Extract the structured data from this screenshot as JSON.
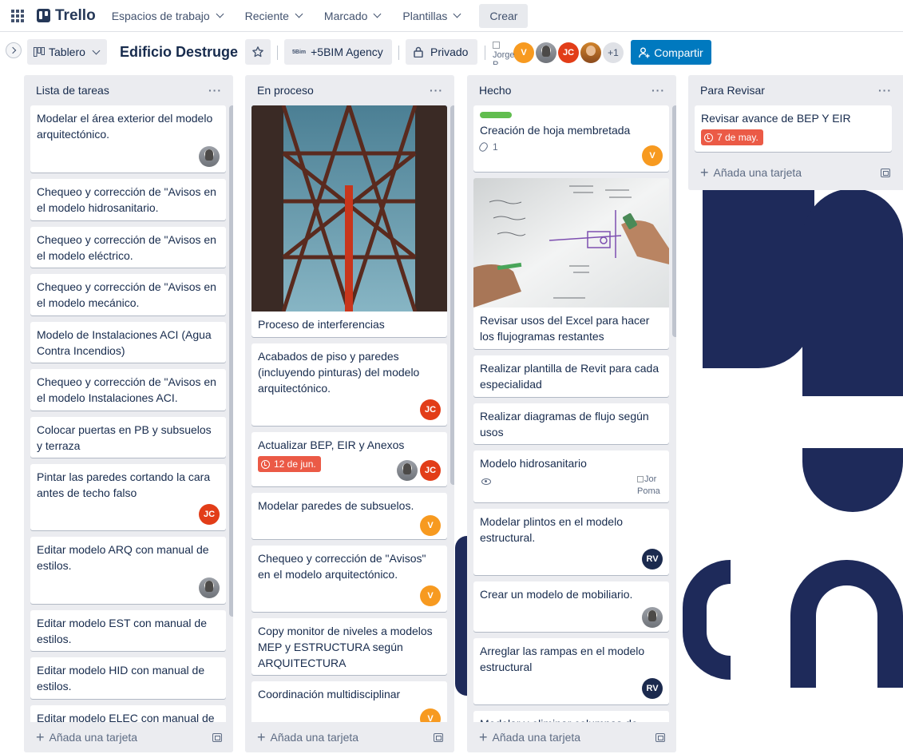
{
  "topnav": {
    "logo": "Trello",
    "items": [
      "Espacios de trabajo",
      "Reciente",
      "Marcado",
      "Plantillas"
    ],
    "create": "Crear"
  },
  "board": {
    "view": "Tablero",
    "title": "Edificio Destruge",
    "workspace_logo": "5Bim",
    "workspace": "+5BIM Agency",
    "visibility": "Privado",
    "members_broken_alt": "Jorge P",
    "members_extra": "+1",
    "share": "Compartir"
  },
  "lists": [
    {
      "title": "Lista de tareas",
      "add_card": "Añada una tarjeta",
      "cards": [
        {
          "text": "Modelar el área exterior del modelo arquitectónico.",
          "members": [
            "photo"
          ]
        },
        {
          "text": "Chequeo y corrección de \"Avisos en el modelo hidrosanitario.",
          "members": []
        },
        {
          "text": "Chequeo y corrección de \"Avisos en el modelo eléctrico.",
          "members": []
        },
        {
          "text": "Chequeo y corrección de \"Avisos en el modelo mecánico.",
          "members": []
        },
        {
          "text": "Modelo de Instalaciones ACI (Agua Contra Incendios)",
          "members": []
        },
        {
          "text": "Chequeo y corrección de \"Avisos en el modelo Instalaciones ACI.",
          "members": []
        },
        {
          "text": "Colocar puertas en PB y subsuelos y terraza",
          "members": []
        },
        {
          "text": "Pintar las paredes cortando la cara antes de techo falso",
          "members": [
            "JC"
          ]
        },
        {
          "text": "Editar modelo ARQ con manual de estilos.",
          "members": [
            "photo"
          ]
        },
        {
          "text": "Editar modelo EST con manual de estilos.",
          "members": []
        },
        {
          "text": "Editar modelo HID con manual de estilos.",
          "members": []
        },
        {
          "text": "Editar modelo ELEC con manual de estilos.",
          "members": []
        }
      ]
    },
    {
      "title": "En proceso",
      "add_card": "Añada una tarjeta",
      "cards": [
        {
          "text": "Proceso de interferencias",
          "members": []
        },
        {
          "text": "Acabados de piso y paredes (incluyendo pinturas) del modelo arquitectónico.",
          "members": [
            "JC"
          ]
        },
        {
          "text": "Actualizar BEP, EIR y Anexos",
          "due": "12 de jun.",
          "members": [
            "photo",
            "JC"
          ]
        },
        {
          "text": "Modelar paredes de subsuelos.",
          "members": [
            "V"
          ]
        },
        {
          "text": "Chequeo y corrección de \"Avisos\" en el modelo arquitectónico.",
          "members": [
            "V"
          ]
        },
        {
          "text": "Copy monitor de niveles a modelos MEP y ESTRUCTURA según ARQUITECTURA",
          "members": []
        },
        {
          "text": "Coordinación multidisciplinar",
          "members": [
            "V"
          ]
        }
      ]
    },
    {
      "title": "Hecho",
      "add_card": "Añada una tarjeta",
      "cards": [
        {
          "text": "Creación de hoja membretada",
          "attachments": "1",
          "members": [
            "V"
          ]
        },
        {
          "text": "Revisar usos del Excel para hacer los flujogramas restantes",
          "members": []
        },
        {
          "text": "Realizar plantilla de Revit para cada especialidad",
          "members": []
        },
        {
          "text": "Realizar diagramas de flujo según usos",
          "members": []
        },
        {
          "text": "Modelo hidrosanitario",
          "broken_alt_1": "Jor",
          "broken_alt_2": "Poma",
          "members": []
        },
        {
          "text": "Modelar plintos en el modelo estructural.",
          "members": [
            "RV"
          ]
        },
        {
          "text": "Crear un modelo de mobiliario.",
          "members": [
            "photo"
          ]
        },
        {
          "text": "Arreglar las rampas en el modelo estructural",
          "members": [
            "RV"
          ]
        },
        {
          "text": "Modelar y eliminar columnas de",
          "members": []
        }
      ]
    },
    {
      "title": "Para Revisar",
      "add_card": "Añada una tarjeta",
      "cards": [
        {
          "text": "Revisar avance de BEP Y EIR",
          "due": "7 de may.",
          "members": []
        }
      ]
    }
  ],
  "colors": {
    "share_button": "#0079bf",
    "due_overdue": "#eb5a46",
    "label_green": "#61bd4f",
    "avatar_jc": "#e23d18",
    "avatar_v": "#f79a20",
    "avatar_rv": "#1b2a4e",
    "board_decoration": "#1e2a5a"
  },
  "icons": [
    "apps-grid-icon",
    "trello-logo-icon",
    "chevron-down-icon",
    "board-view-icon",
    "star-icon",
    "lock-icon",
    "add-member-icon",
    "more-dots-icon",
    "template-icon",
    "clock-icon",
    "attachment-icon",
    "watch-eye-icon",
    "sidebar-expand-icon"
  ]
}
